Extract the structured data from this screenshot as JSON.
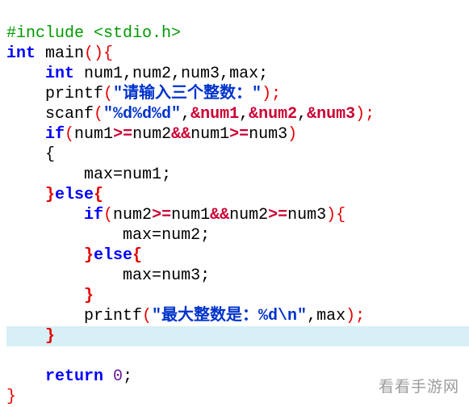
{
  "code": {
    "l1_include": "#include ",
    "l1_header": "<stdio.h>",
    "l2_int": "int",
    "l2_main": " main",
    "l2_paren": "()",
    "l2_brace": "{",
    "l3_indent": "    ",
    "l3_int": "int",
    "l3_rest": " num1,num2,num3,max;",
    "l4_indent": "    ",
    "l4_fn": "printf",
    "l4_open": "(",
    "l4_str": "\"请输入三个整数：\"",
    "l4_close": ");",
    "l5_indent": "    ",
    "l5_fn": "scanf",
    "l5_open": "(",
    "l5_str": "\"%d%d%d\"",
    "l5_mid1": ",",
    "l5_a1": "&num1",
    "l5_mid2": ",",
    "l5_a2": "&num2",
    "l5_mid3": ",",
    "l5_a3": "&num3",
    "l5_close": ");",
    "l6_indent": "    ",
    "l6_if": "if",
    "l6_open": "(",
    "l6_c1": "num1",
    "l6_ge1": ">=",
    "l6_c2": "num2",
    "l6_and1": "&&",
    "l6_c3": "num1",
    "l6_ge2": ">=",
    "l6_c4": "num3",
    "l6_close": ")",
    "l7": "    {",
    "l8_indent": "        ",
    "l8_lhs": "max",
    "l8_eq": "=",
    "l8_rhs": "num1",
    "l8_semi": ";",
    "l9_indent": "    ",
    "l9_close": "}",
    "l9_else": "else",
    "l9_open": "{",
    "l10_indent": "        ",
    "l10_if": "if",
    "l10_open": "(",
    "l10_c1": "num2",
    "l10_ge1": ">=",
    "l10_c2": "num1",
    "l10_and1": "&&",
    "l10_c3": "num2",
    "l10_ge2": ">=",
    "l10_c4": "num3",
    "l10_close": ")",
    "l10_brace": "{",
    "l11_indent": "            ",
    "l11_lhs": "max",
    "l11_eq": "=",
    "l11_rhs": "num2",
    "l11_semi": ";",
    "l12_indent": "        ",
    "l12_close": "}",
    "l12_else": "else",
    "l12_open": "{",
    "l13_indent": "            ",
    "l13_lhs": "max",
    "l13_eq": "=",
    "l13_rhs": "num3",
    "l13_semi": ";",
    "l14_indent": "        ",
    "l14_close": "}",
    "l15_indent": "        ",
    "l15_fn": "printf",
    "l15_open": "(",
    "l15_str": "\"最大整数是：%d\\n\"",
    "l15_mid": ",max",
    "l15_close": ");",
    "l16_indent": "    ",
    "l16_close": "}",
    "l17_indent": "    ",
    "l17_return": "return",
    "l17_sp": " ",
    "l17_val": "0",
    "l17_semi": ";",
    "l18_close": "}"
  },
  "watermark": "看看手游网"
}
